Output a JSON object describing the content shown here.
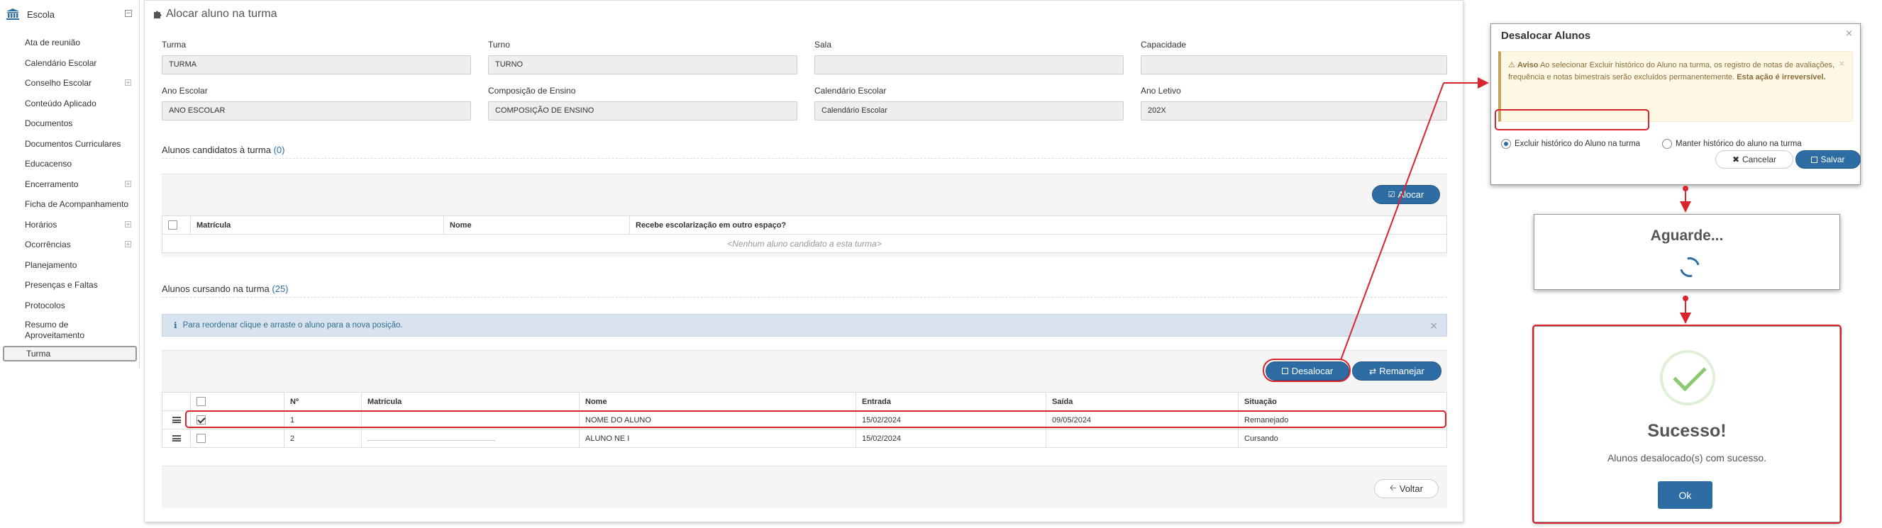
{
  "sidebar": {
    "header": "Escola",
    "items": [
      {
        "label": "Ata de reunião",
        "expandable": false
      },
      {
        "label": "Calendário Escolar",
        "expandable": false
      },
      {
        "label": "Conselho Escolar",
        "expandable": true
      },
      {
        "label": "Conteúdo Aplicado",
        "expandable": false
      },
      {
        "label": "Documentos",
        "expandable": false
      },
      {
        "label": "Documentos Curriculares",
        "expandable": false
      },
      {
        "label": "Educacenso",
        "expandable": false
      },
      {
        "label": "Encerramento",
        "expandable": true
      },
      {
        "label": "Ficha de Acompanhamento",
        "expandable": false
      },
      {
        "label": "Horários",
        "expandable": true
      },
      {
        "label": "Ocorrências",
        "expandable": true
      },
      {
        "label": "Planejamento",
        "expandable": false
      },
      {
        "label": "Presenças e Faltas",
        "expandable": false
      },
      {
        "label": "Protocolos",
        "expandable": false
      },
      {
        "label": "Resumo de Aproveitamento",
        "expandable": false
      },
      {
        "label": "Turma",
        "expandable": false,
        "active": true
      }
    ]
  },
  "page": {
    "title": "Alocar aluno na turma",
    "fields": {
      "turma": {
        "label": "Turma",
        "value": "TURMA"
      },
      "turno": {
        "label": "Turno",
        "value": "TURNO"
      },
      "sala": {
        "label": "Sala",
        "value": ""
      },
      "capacidade": {
        "label": "Capacidade",
        "value": ""
      },
      "ano_escolar": {
        "label": "Ano Escolar",
        "value": "ANO ESCOLAR"
      },
      "composicao": {
        "label": "Composição de Ensino",
        "value": "COMPOSIÇÃO DE ENSINO"
      },
      "calendario": {
        "label": "Calendário Escolar",
        "value": "Calendário Escolar"
      },
      "ano_letivo": {
        "label": "Ano Letivo",
        "value": "202X"
      }
    },
    "candidatos": {
      "title": "Alunos candidatos à turma",
      "count": "(0)",
      "alocar_label": "Alocar",
      "headers": [
        "Matrícula",
        "Nome",
        "Recebe escolarização em outro espaço?"
      ],
      "empty": "<Nenhum aluno candidato a esta turma>"
    },
    "cursando": {
      "title": "Alunos cursando na turma",
      "count": "(25)",
      "info": "Para reordenar clique e arraste o aluno para a nova posição.",
      "desalocar_label": "Desalocar",
      "remanejar_label": "Remanejar",
      "headers": [
        "Nº",
        "Matrícula",
        "Nome",
        "Entrada",
        "Saída",
        "Situação"
      ],
      "rows": [
        {
          "n": "1",
          "matricula": "",
          "nome": "NOME DO ALUNO",
          "entrada": "15/02/2024",
          "saida": "09/05/2024",
          "situacao": "Remanejado",
          "checked": true
        },
        {
          "n": "2",
          "matricula": "",
          "nome": "ALUNO NE I",
          "entrada": "15/02/2024",
          "saida": "",
          "situacao": "Cursando",
          "checked": false
        }
      ]
    },
    "voltar_label": "Voltar"
  },
  "modal_desalocar": {
    "title": "Desalocar Alunos",
    "warning_label": "Aviso",
    "warning_text": "Ao selecionar Excluir histórico do Aluno na turma, os registro de notas de avaliações, frequência e notas bimestrais serão excluídos permanentemente.",
    "warning_strong": "Esta ação é irreversível.",
    "option_excluir": "Excluir histórico do Aluno na turma",
    "option_manter": "Manter histórico do aluno na turma",
    "cancel_label": "Cancelar",
    "save_label": "Salvar"
  },
  "modal_aguarde": {
    "title": "Aguarde..."
  },
  "modal_sucesso": {
    "title": "Sucesso!",
    "message": "Alunos desalocado(s) com sucesso.",
    "ok_label": "Ok"
  },
  "colors": {
    "primary": "#2e6da4",
    "annotation_red": "#d9232d",
    "info_bg": "#d9e3ef",
    "warning_bg": "#fcf8e3"
  }
}
